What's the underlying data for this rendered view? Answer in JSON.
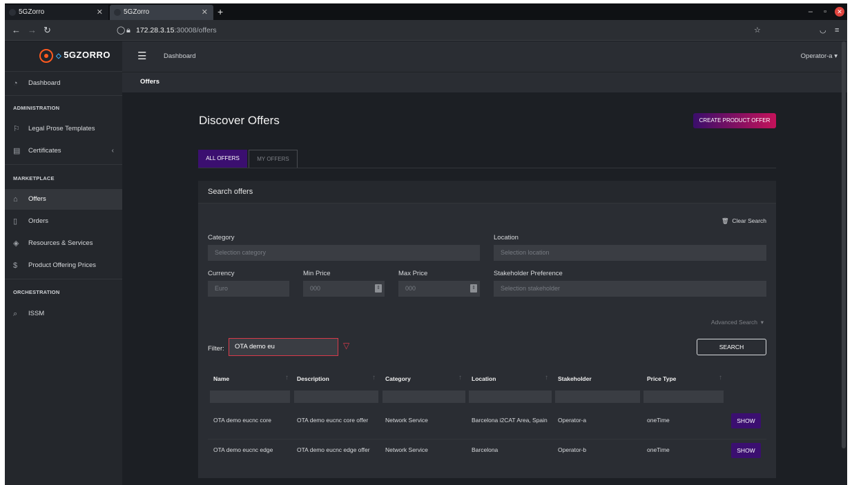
{
  "browser": {
    "tabs": [
      {
        "title": "5GZorro"
      },
      {
        "title": "5GZorro"
      }
    ],
    "url": {
      "host": "172.28.3.15",
      "path": ":30008/offers"
    }
  },
  "app": {
    "brand": "5GZORRO",
    "header": {
      "dashboard_link": "Dashboard",
      "user": "Operator-a"
    },
    "breadcrumb": "Offers"
  },
  "sidebar": {
    "dashboard": "Dashboard",
    "sections": [
      {
        "title": "ADMINISTRATION"
      },
      {
        "title": "MARKETPLACE"
      },
      {
        "title": "ORCHESTRATION"
      }
    ],
    "items": [
      {
        "label": "Legal Prose Templates",
        "icon": "flag-icon"
      },
      {
        "label": "Certificates",
        "icon": "certificate-icon"
      },
      {
        "label": "Offers",
        "icon": "tag-icon"
      },
      {
        "label": "Orders",
        "icon": "bookmark-icon"
      },
      {
        "label": "Resources & Services",
        "icon": "layers-icon"
      },
      {
        "label": "Product Offering Prices",
        "icon": "dollar-icon"
      },
      {
        "label": "ISSM",
        "icon": "paperclip-icon"
      }
    ]
  },
  "main": {
    "title": "Discover Offers",
    "create_button": "CREATE PRODUCT OFFER",
    "tabs": [
      {
        "label": "ALL OFFERS",
        "active": true
      },
      {
        "label": "MY OFFERS",
        "active": false
      }
    ],
    "search": {
      "title": "Search offers",
      "clear": "Clear Search",
      "category": {
        "label": "Category",
        "placeholder": "Selection category"
      },
      "location": {
        "label": "Location",
        "placeholder": "Selection location"
      },
      "currency": {
        "label": "Currency",
        "placeholder": "Euro"
      },
      "min_price": {
        "label": "Min Price",
        "placeholder": "000"
      },
      "max_price": {
        "label": "Max Price",
        "placeholder": "000"
      },
      "stakeholder": {
        "label": "Stakeholder Preference",
        "placeholder": "Selection stakeholder"
      },
      "advanced": "Advanced Search",
      "filter_label": "Filter:",
      "filter_value": "OTA demo eu",
      "search_button": "SEARCH"
    },
    "table": {
      "columns": [
        "Name",
        "Description",
        "Category",
        "Location",
        "Stakeholder",
        "Price Type"
      ],
      "rows": [
        {
          "name": "OTA demo eucnc core",
          "description": "OTA demo eucnc core offer",
          "category": "Network Service",
          "location": "Barcelona i2CAT Area, Spain",
          "stakeholder": "Operator-a",
          "price_type": "oneTime",
          "action": "SHOW"
        },
        {
          "name": "OTA demo eucnc edge",
          "description": "OTA demo eucnc edge offer",
          "category": "Network Service",
          "location": "Barcelona",
          "stakeholder": "Operator-b",
          "price_type": "oneTime",
          "action": "SHOW"
        }
      ]
    }
  },
  "colors": {
    "accent": "#3b0f70",
    "gradient_end": "#c4125a",
    "brand_orange": "#ff5a1f",
    "filter_border": "#d83a4a"
  }
}
